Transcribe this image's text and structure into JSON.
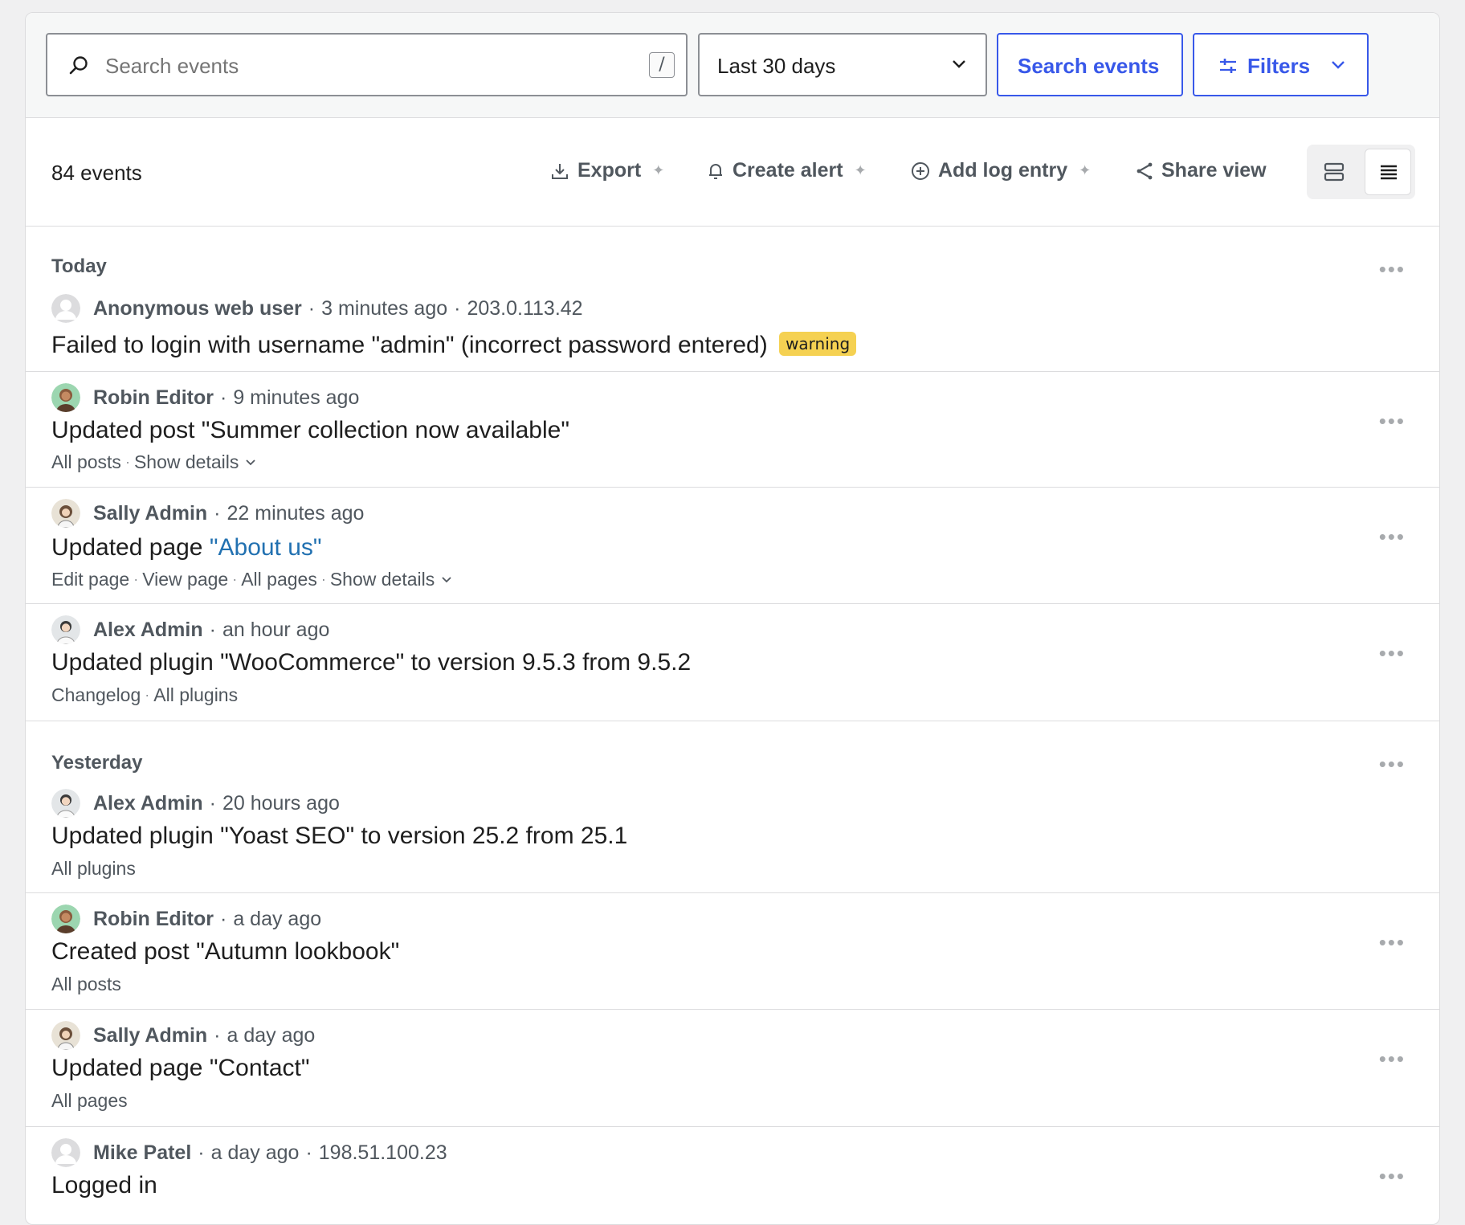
{
  "search": {
    "placeholder": "Search events",
    "shortcut": "/",
    "date_range": "Last 30 days",
    "search_button": "Search events",
    "filters_button": "Filters"
  },
  "toolbar": {
    "count": "84 events",
    "export": "Export",
    "create_alert": "Create alert",
    "add_log_entry": "Add log entry",
    "share_view": "Share view"
  },
  "groups": {
    "today": "Today",
    "yesterday": "Yesterday"
  },
  "events": [
    {
      "user": "Anonymous web user",
      "time": "3 minutes ago",
      "ip": "203.0.113.42",
      "message": "Failed to login with username \"admin\" (incorrect password entered)",
      "badge": "warning"
    },
    {
      "user": "Robin Editor",
      "time": "9 minutes ago",
      "message": "Updated post \"Summer collection now available\"",
      "links": [
        "All posts",
        "Show details"
      ]
    },
    {
      "user": "Sally Admin",
      "time": "22 minutes ago",
      "message_prefix": "Updated page",
      "message_link": "\"About us\"",
      "links": [
        "Edit page",
        "View page",
        "All pages",
        "Show details"
      ]
    },
    {
      "user": "Alex Admin",
      "time": "an hour ago",
      "message": "Updated plugin \"WooCommerce\" to version 9.5.3 from 9.5.2",
      "links": [
        "Changelog",
        "All plugins"
      ]
    },
    {
      "user": "Alex Admin",
      "time": "20 hours ago",
      "message": "Updated plugin \"Yoast SEO\" to version 25.2 from 25.1",
      "links": [
        "All plugins"
      ]
    },
    {
      "user": "Robin Editor",
      "time": "a day ago",
      "message": "Created post \"Autumn lookbook\"",
      "links": [
        "All posts"
      ]
    },
    {
      "user": "Sally Admin",
      "time": "a day ago",
      "message": "Updated page \"Contact\"",
      "links": [
        "All pages"
      ]
    },
    {
      "user": "Mike Patel",
      "time": "a day ago",
      "ip": "198.51.100.23",
      "message": "Logged in"
    }
  ],
  "more_label": "•••",
  "colors": {
    "accent": "#3858e9",
    "link": "#2271b1",
    "warning_badge": "#f5d152"
  }
}
